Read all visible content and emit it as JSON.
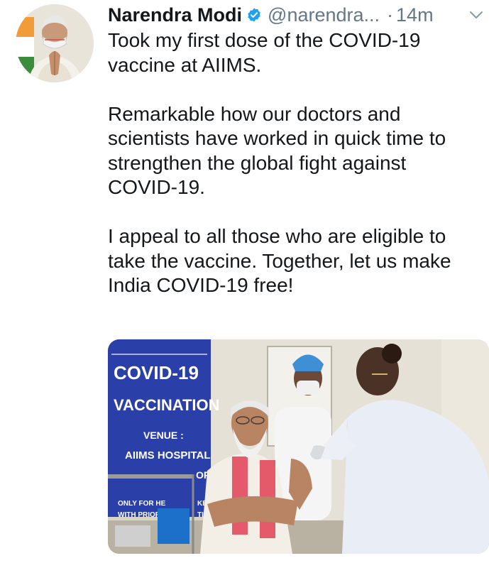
{
  "tweet": {
    "author_name": "Narendra Modi",
    "handle": "@narendra...",
    "separator": "·",
    "time": "14m",
    "paragraphs": [
      "Took my first dose of the COVID-19\nvaccine at AIIMS.",
      "Remarkable how our doctors and\nscientists have worked in quick time to\nstrengthen the global fight against\nCOVID-19.",
      "I appeal to all those who are eligible to\ntake the vaccine. Together, let us make\nIndia COVID-19 free!"
    ]
  },
  "media": {
    "sign": {
      "line1": "COVID-19",
      "line2": "VACCINATION",
      "line3": "VENUE :",
      "line4": "AIIMS HOSPITAL",
      "side": "OR",
      "small1": "ONLY FOR HE",
      "small2": "WITH PRIOR",
      "small3": "KEE",
      "small4": "TIO"
    }
  },
  "icons": {
    "verified": "verified-badge-icon",
    "chevron": "chevron-down-icon"
  },
  "colors": {
    "text": "#14171a",
    "muted": "#657786",
    "verified": "#1da1f2",
    "sign_blue": "#2b3fa8"
  }
}
